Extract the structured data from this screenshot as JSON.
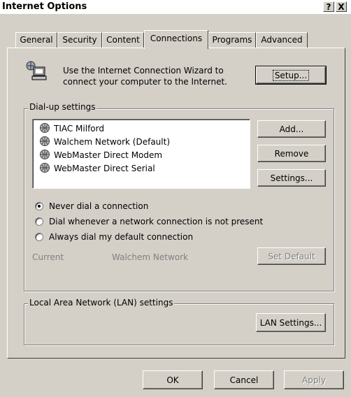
{
  "window": {
    "title": "Internet Options",
    "help_button": "?",
    "close_button": "X"
  },
  "tabs": [
    {
      "label": "General"
    },
    {
      "label": "Security"
    },
    {
      "label": "Content"
    },
    {
      "label": "Connections",
      "active": true
    },
    {
      "label": "Programs"
    },
    {
      "label": "Advanced"
    }
  ],
  "wizard": {
    "text_line1": "Use the Internet Connection Wizard to",
    "text_line2": "connect your computer to the Internet.",
    "setup_button": "Setup...",
    "icon": "computer-network-icon"
  },
  "dialup": {
    "legend": "Dial-up settings",
    "connections": [
      {
        "label": "TIAC Milford"
      },
      {
        "label": "Walchem Network (Default)"
      },
      {
        "label": "WebMaster Direct Modem"
      },
      {
        "label": "WebMaster Direct Serial"
      }
    ],
    "add_button": "Add...",
    "remove_button": "Remove",
    "settings_button": "Settings...",
    "radio_options": [
      {
        "label": "Never dial a connection",
        "checked": true
      },
      {
        "label": "Dial whenever a network connection is not present",
        "checked": false
      },
      {
        "label": "Always dial my default connection",
        "checked": false
      }
    ],
    "current_label": "Current",
    "current_value": "Walchem Network",
    "set_default_button": "Set Default"
  },
  "lan": {
    "legend": "Local Area Network (LAN) settings",
    "lan_settings_button": "LAN Settings..."
  },
  "footer": {
    "ok_button": "OK",
    "cancel_button": "Cancel",
    "apply_button": "Apply"
  }
}
